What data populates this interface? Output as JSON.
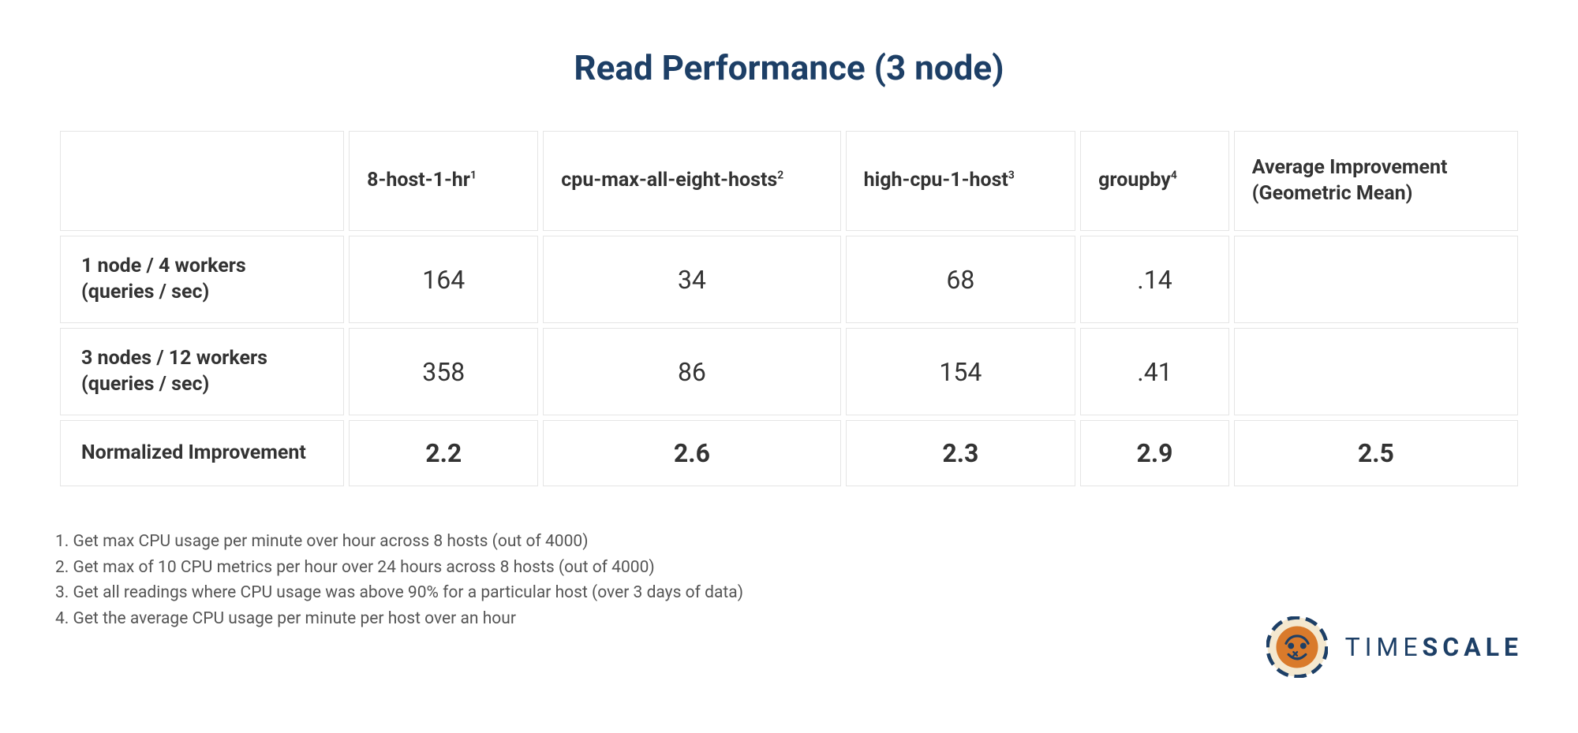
{
  "title": "Read Performance (3 node)",
  "chart_data": {
    "type": "table",
    "title": "Read Performance (3 node)",
    "columns": [
      {
        "label": "",
        "footnote": ""
      },
      {
        "label": "8-host-1-hr",
        "footnote": "1"
      },
      {
        "label": "cpu-max-all-eight-hosts",
        "footnote": "2"
      },
      {
        "label": "high-cpu-1-host",
        "footnote": "3"
      },
      {
        "label": "groupby",
        "footnote": "4"
      },
      {
        "label": "Average Improvement (Geometric Mean)",
        "footnote": ""
      }
    ],
    "rows": [
      {
        "label": "1 node / 4 workers (queries / sec)",
        "values": [
          "164",
          "34",
          "68",
          ".14",
          ""
        ],
        "bold": false
      },
      {
        "label": "3 nodes / 12 workers (queries / sec)",
        "values": [
          "358",
          "86",
          "154",
          ".41",
          ""
        ],
        "bold": false
      },
      {
        "label": "Normalized Improvement",
        "values": [
          "2.2",
          "2.6",
          "2.3",
          "2.9",
          "2.5"
        ],
        "bold": true
      }
    ]
  },
  "footnotes": [
    "1. Get max CPU usage per minute over hour across 8 hosts (out of 4000)",
    "2. Get max of 10 CPU metrics per hour over 24 hours across 8 hosts (out of 4000)",
    "3. Get all readings where CPU usage was above 90% for a particular host (over 3 days of data)",
    "4. Get the average CPU usage per minute per host over an hour"
  ],
  "brand": {
    "name_light": "TIME",
    "name_bold": "SCALE"
  }
}
